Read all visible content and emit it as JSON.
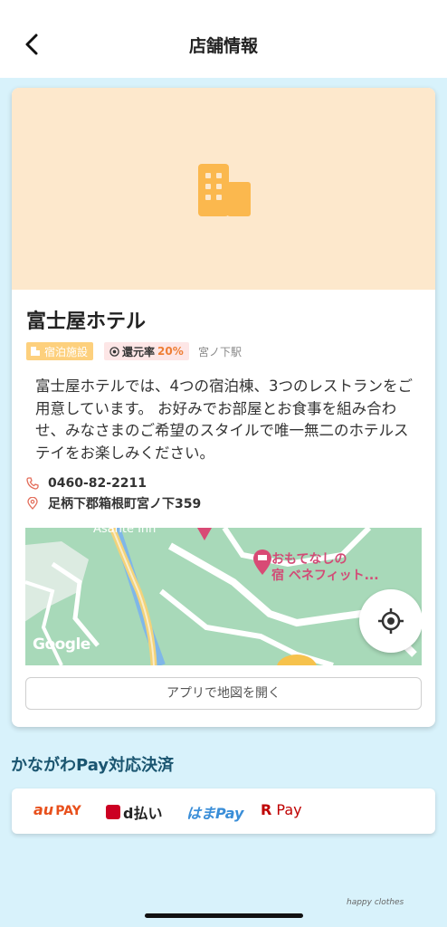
{
  "header": {
    "title": "店舗情報",
    "back_icon": "chevron-left-icon"
  },
  "shop": {
    "name": "富士屋ホテル",
    "category_tag": "宿泊施設",
    "return_label": "還元率",
    "return_rate": "20%",
    "station": "宮ノ下駅",
    "description": "富士屋ホテルでは、4つの宿泊棟、3つのレストランをご用意しています。 お好みでお部屋とお食事を組み合わせ、みなさまのご希望のスタイルで唯一無二のホテルステイをお楽しみください。",
    "phone": "0460-82-2211",
    "address": "足柄下郡箱根町宮ノ下359"
  },
  "map": {
    "poi_label_line1": "おもてなしの",
    "poi_label_line2": "宿 ベネフィット...",
    "top_label": "Asante Inn",
    "google_logo": "Google",
    "open_button": "アプリで地図を開く"
  },
  "payments": {
    "title": "かながわPay対応決済",
    "au_pay_1": "au",
    "au_pay_2": "PAY",
    "d_pay": "d払い",
    "hama_pay": "はまPay",
    "r_pay_1": "R",
    "r_pay_2": " Pay"
  },
  "watermark": "happy clothes",
  "colors": {
    "accent_orange": "#fdd07d",
    "hero_bg": "#fde8cc",
    "page_bg": "#d8f2fb",
    "title_blue": "#1a5570"
  }
}
